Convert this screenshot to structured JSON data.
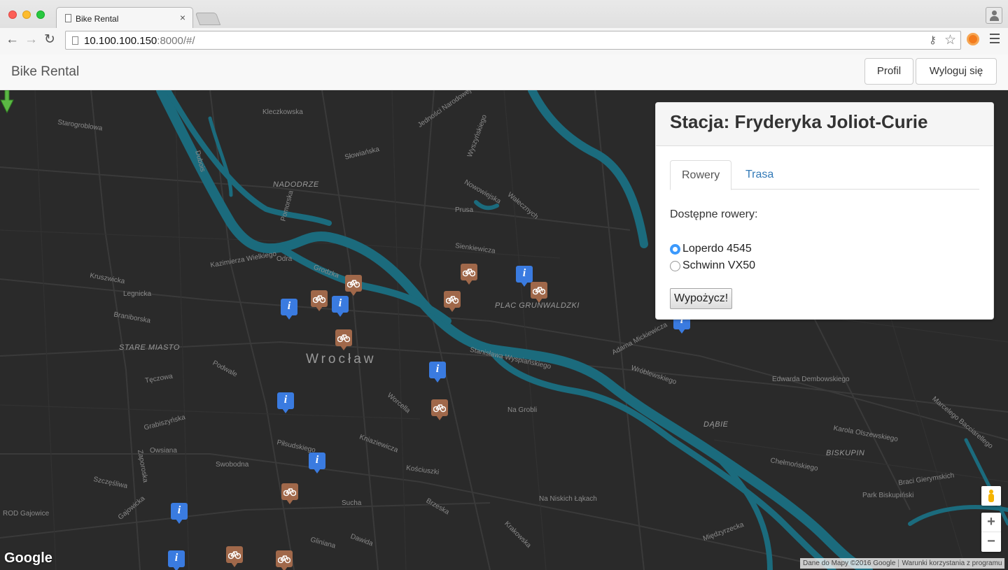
{
  "browser": {
    "tab_title": "Bike Rental",
    "tab_close": "×",
    "url_host": "10.100.100.150",
    "url_rest": ":8000/#/"
  },
  "navbar": {
    "brand": "Bike Rental",
    "profile_button": "Profil",
    "logout_button": "Wyloguj się"
  },
  "station_panel": {
    "title": "Stacja: Fryderyka Joliot-Curie",
    "tabs": [
      {
        "label": "Rowery",
        "active": true
      },
      {
        "label": "Trasa",
        "active": false
      }
    ],
    "available_label": "Dostępne rowery:",
    "bikes": [
      {
        "label": "Loperdo 4545",
        "selected": true
      },
      {
        "label": "Schwinn VX50",
        "selected": false
      }
    ],
    "rent_button": "Wypożycz!"
  },
  "map": {
    "city_label": "Wrocław",
    "labels": [
      "Kleczkowska",
      "Starogroblowa",
      "NADODRZE",
      "Słowiańska",
      "Jedności Narodowej",
      "Wyszyńskiego",
      "Nowowiejska",
      "Prusa",
      "Wałecznych",
      "Sienkiewicza",
      "Kruszwicka",
      "Legnicka",
      "Braniborska",
      "STARE MIASTO",
      "Grodzka",
      "Odra",
      "PLAC GRUNWALDZKI",
      "Adama Mickiewicza",
      "Wróblewskiego",
      "Edwarda Dembowskiego",
      "DĄBIE",
      "BISKUPIN",
      "Karola Olszewskiego",
      "Chełmońskiego",
      "Braci Gierymskich",
      "Park Biskupiński",
      "Na Grobli",
      "Na Niskich Łąkach",
      "Międzyrzecka",
      "Kościuszki",
      "Piłsudskiego",
      "Podwale",
      "Sucha",
      "Dawida",
      "Gliniana",
      "Swobodna",
      "Grabiszyńska",
      "Owsiana",
      "Gajowicka",
      "Zaporoska",
      "Tęczowa",
      "Szczęśliwa",
      "Kniaziewicza",
      "Worcella",
      "Krakowska",
      "Brzeska",
      "ROD Gajowice",
      "Stanisława Wyspiańskiego",
      "Pomorska",
      "Dubois",
      "Kazimierza Wielkiego",
      "Marcelego Bacciarellego"
    ],
    "google_logo": "Google",
    "attribution_data": "Dane do Mapy ©2016 Google",
    "attribution_terms": "Warunki korzystania z programu",
    "zoom_in": "+",
    "zoom_out": "−"
  },
  "colors": {
    "map_background": "#2a2a2a",
    "river": "#1b6b7d",
    "info_marker": "#3a7be0",
    "bike_marker": "#a0684a",
    "selected_station_marker": "#5bb844",
    "link": "#337ab7"
  },
  "icons": {
    "info_marker": "info-marker-icon",
    "bike_marker": "bike-station-icon",
    "selected_marker": "green-arrow-marker-icon"
  }
}
